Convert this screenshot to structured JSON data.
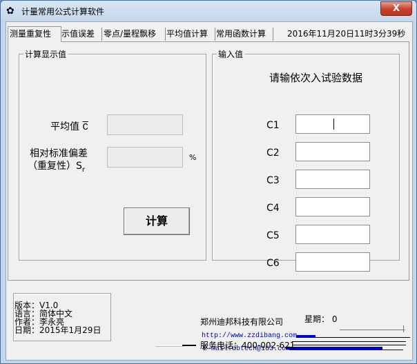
{
  "window": {
    "title": "计量常用公式计算软件",
    "close_label": "X"
  },
  "tabs": [
    {
      "label": "测量重复性",
      "active": true
    },
    {
      "label": "示值误差",
      "active": false
    },
    {
      "label": "零点/量程飘移",
      "active": false
    },
    {
      "label": "平均值计算",
      "active": false
    },
    {
      "label": "常用函数计算",
      "active": false
    }
  ],
  "datetime": "2016年11月20日11时3分39秒",
  "calc_group": {
    "legend": "计算显示值",
    "avg_label": "平均值",
    "avg_symbol": "C",
    "rsd_label_1": "相对标准偏差",
    "rsd_label_2": "（重复性）S",
    "rsd_sub": "r",
    "percent": "%",
    "calc_button": "计算"
  },
  "input_group": {
    "legend": "输入值",
    "prompt": "请输依次入试验数据",
    "fields": [
      {
        "label": "C1",
        "value": ""
      },
      {
        "label": "C2",
        "value": ""
      },
      {
        "label": "C3",
        "value": ""
      },
      {
        "label": "C4",
        "value": ""
      },
      {
        "label": "C5",
        "value": ""
      },
      {
        "label": "C6",
        "value": ""
      }
    ]
  },
  "info": {
    "version": "版本：V1.0",
    "language": "语言：简体中文",
    "author": "作者：李永亮",
    "date": "日期：2015年1月29日"
  },
  "footer": {
    "company": "郑州迪邦科技有限公司",
    "weekday": "星期：  0",
    "url": "http://www.zzdibang.com",
    "email": "E-mail:dbtech@163.com",
    "phone": "服务电话：400-002-621"
  },
  "colors": {
    "link": "#0000a0",
    "accent_bar": "#0000d0",
    "close_button": "#c7462f"
  }
}
